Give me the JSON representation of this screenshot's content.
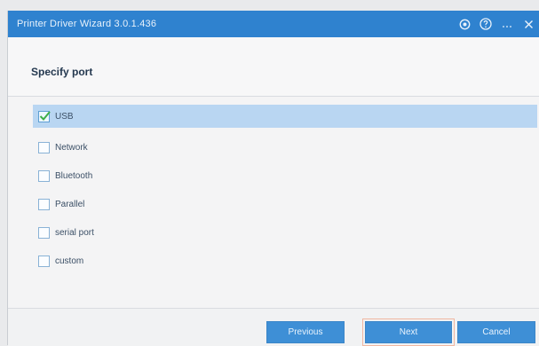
{
  "window": {
    "title": "Printer Driver Wizard  3.0.1.436",
    "controls": [
      {
        "name": "settings-icon",
        "glyph": "gear"
      },
      {
        "name": "help-icon",
        "glyph": "?"
      },
      {
        "name": "minimize-icon",
        "glyph": "…"
      },
      {
        "name": "close-icon",
        "glyph": "×"
      }
    ]
  },
  "header": {
    "title": "Specify port"
  },
  "ports": [
    {
      "label": "USB",
      "checked": true,
      "selected": true
    },
    {
      "label": "Network",
      "checked": false,
      "selected": false
    },
    {
      "label": "Bluetooth",
      "checked": false,
      "selected": false
    },
    {
      "label": "Parallel",
      "checked": false,
      "selected": false
    },
    {
      "label": "serial port",
      "checked": false,
      "selected": false
    },
    {
      "label": "custom",
      "checked": false,
      "selected": false
    }
  ],
  "footer": {
    "previous_label": "Previous",
    "next_label": "Next",
    "cancel_label": "Cancel"
  },
  "colors": {
    "titlebar": "#2f82cf",
    "selection": "#b9d6f2",
    "button": "#3e8fd6",
    "focus_outline": "#f0b7a1"
  }
}
